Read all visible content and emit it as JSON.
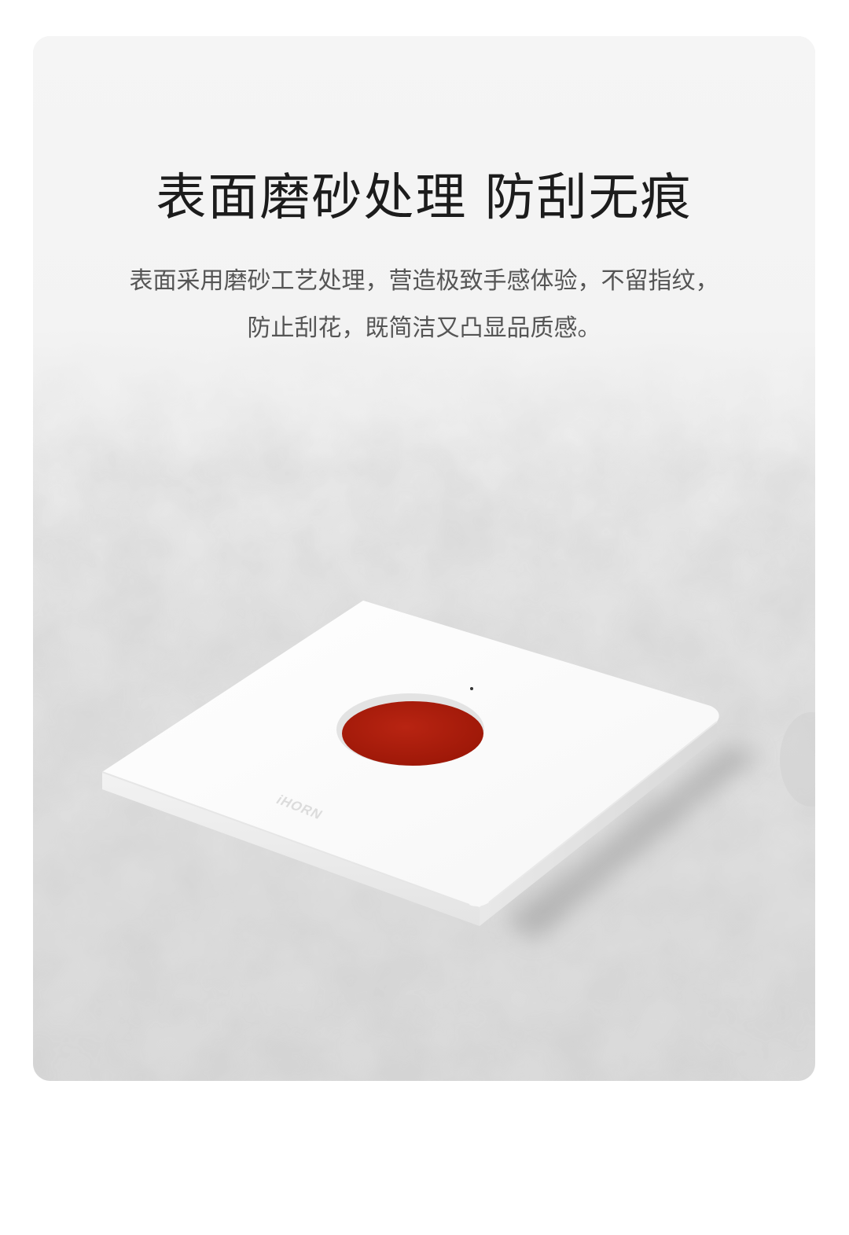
{
  "headline": "表面磨砂处理 防刮无痕",
  "body": {
    "line1": "表面采用磨砂工艺处理，营造极致手感体验，不留指纹，",
    "line2": "防止刮花，既简洁又凸显品质感。"
  },
  "product": {
    "brand_mark": "iHORN",
    "button_color": "#aa1a0a",
    "plate_color": "#ffffff"
  },
  "colors": {
    "background": "#eeeeee",
    "headline": "#1c1c1c",
    "body": "#555555"
  }
}
